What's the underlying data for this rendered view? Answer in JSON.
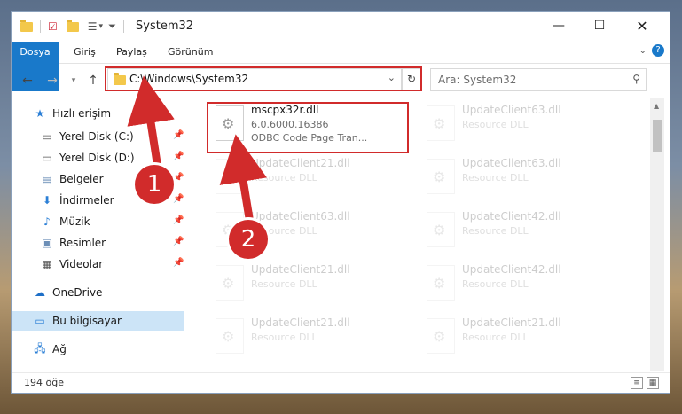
{
  "window": {
    "title": "System32",
    "ribbon_tabs": [
      "Dosya",
      "Giriş",
      "Paylaş",
      "Görünüm"
    ],
    "address": "C:\\Windows\\System32",
    "search_placeholder": "Ara: System32",
    "status_count": "194 öğe"
  },
  "sidebar": {
    "quick_access": "Hızlı erişim",
    "items": [
      {
        "label": "Yerel Disk (C:)",
        "icon": "drive-icon"
      },
      {
        "label": "Yerel Disk (D:)",
        "icon": "drive-icon"
      },
      {
        "label": "Belgeler",
        "icon": "documents-icon"
      },
      {
        "label": "İndirmeler",
        "icon": "download-icon"
      },
      {
        "label": "Müzik",
        "icon": "music-icon"
      },
      {
        "label": "Resimler",
        "icon": "pictures-icon"
      },
      {
        "label": "Videolar",
        "icon": "video-icon"
      }
    ],
    "onedrive": "OneDrive",
    "this_pc": "Bu bilgisayar",
    "network": "Ağ"
  },
  "files": [
    {
      "name": "mscpx32r.dll",
      "line1": "6.0.6000.16386",
      "line2": "ODBC Code Page Tran..."
    },
    {
      "name": "UpdateClient63.dll",
      "line1": "Resource DLL"
    },
    {
      "name": "UpdateClient21.dll",
      "line1": "Resource DLL"
    },
    {
      "name": "UpdateClient63.dll",
      "line1": "Resource DLL"
    },
    {
      "name": "UpdateClient63.dll",
      "line1": "Resource DLL"
    },
    {
      "name": "UpdateClient42.dll",
      "line1": "Resource DLL"
    },
    {
      "name": "UpdateClient21.dll",
      "line1": "Resource DLL"
    },
    {
      "name": "UpdateClient42.dll",
      "line1": "Resource DLL"
    },
    {
      "name": "UpdateClient21.dll",
      "line1": "Resource DLL"
    },
    {
      "name": "UpdateClient21.dll",
      "line1": "Resource DLL"
    }
  ],
  "annotations": {
    "step1": "1",
    "step2": "2"
  }
}
